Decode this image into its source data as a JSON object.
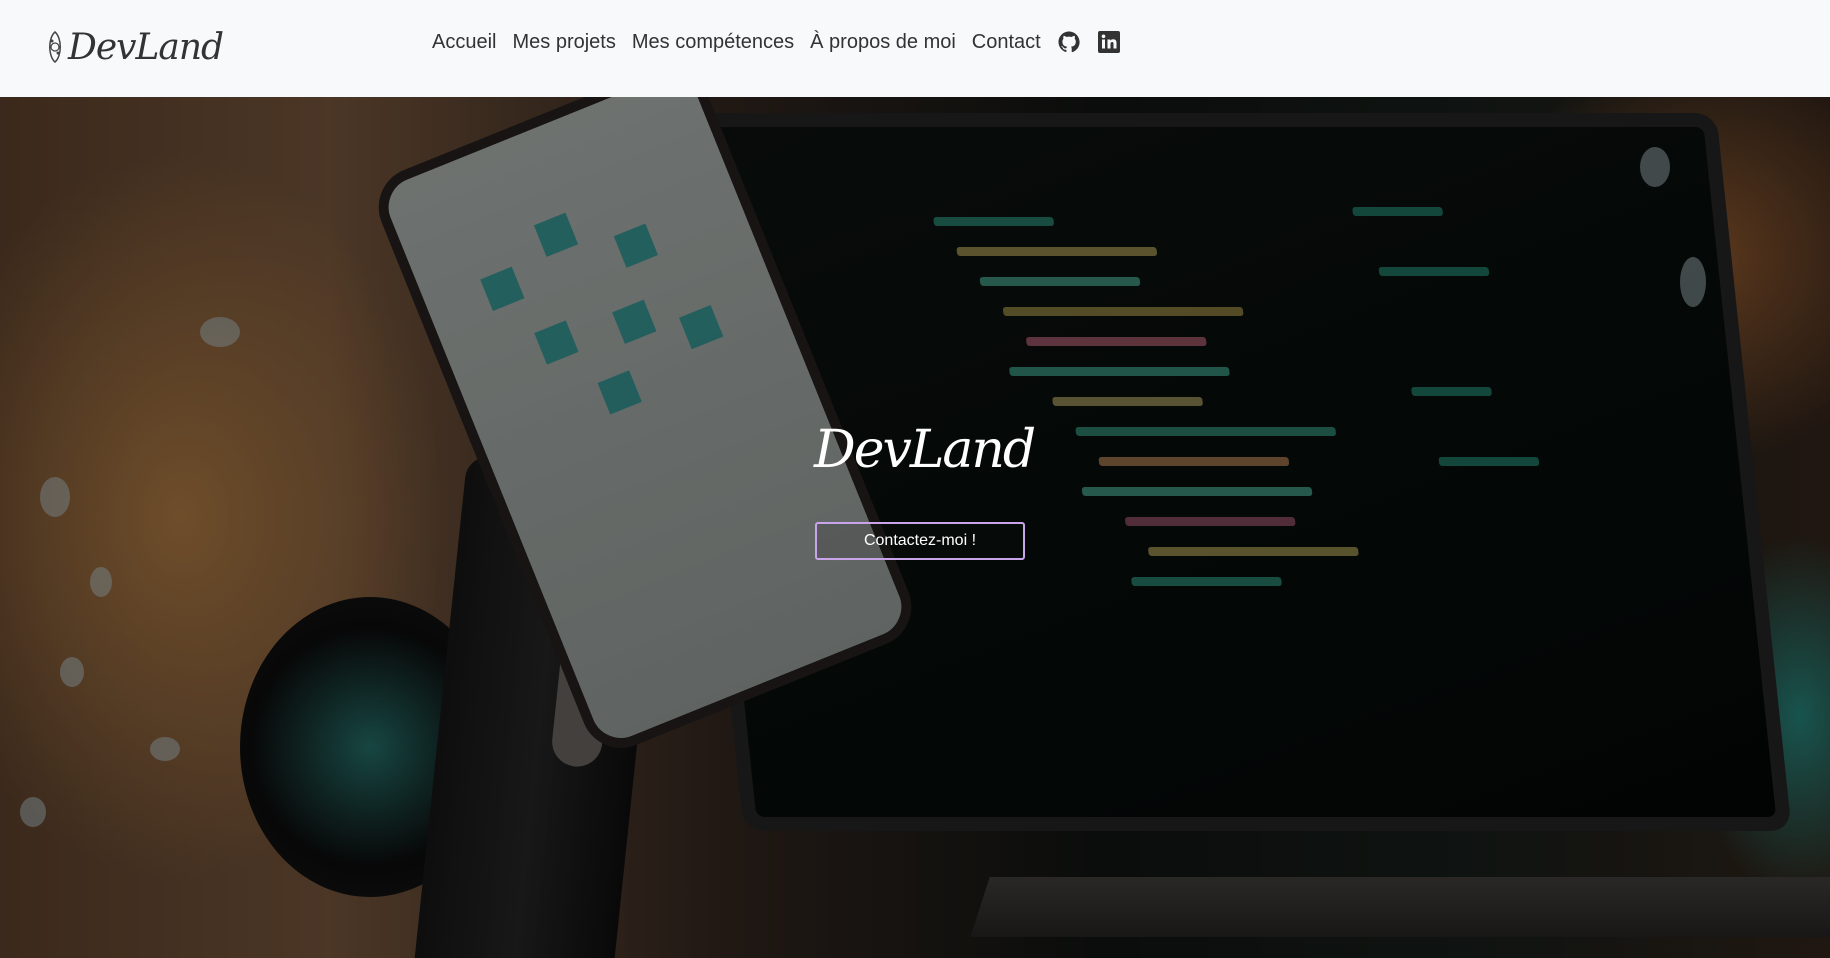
{
  "brand": {
    "logo_text": "DevLand"
  },
  "nav": {
    "items": [
      {
        "label": "Accueil"
      },
      {
        "label": "Mes projets"
      },
      {
        "label": "Mes compétences"
      },
      {
        "label": "À propos de moi"
      },
      {
        "label": "Contact"
      }
    ],
    "icons": [
      "github-icon",
      "linkedin-icon"
    ]
  },
  "hero": {
    "title": "DevLand",
    "cta_label": "Contactez-moi !"
  },
  "colors": {
    "navbar_bg": "#f8f9fa",
    "nav_text": "#333333",
    "cta_border": "#c9a4ea"
  }
}
